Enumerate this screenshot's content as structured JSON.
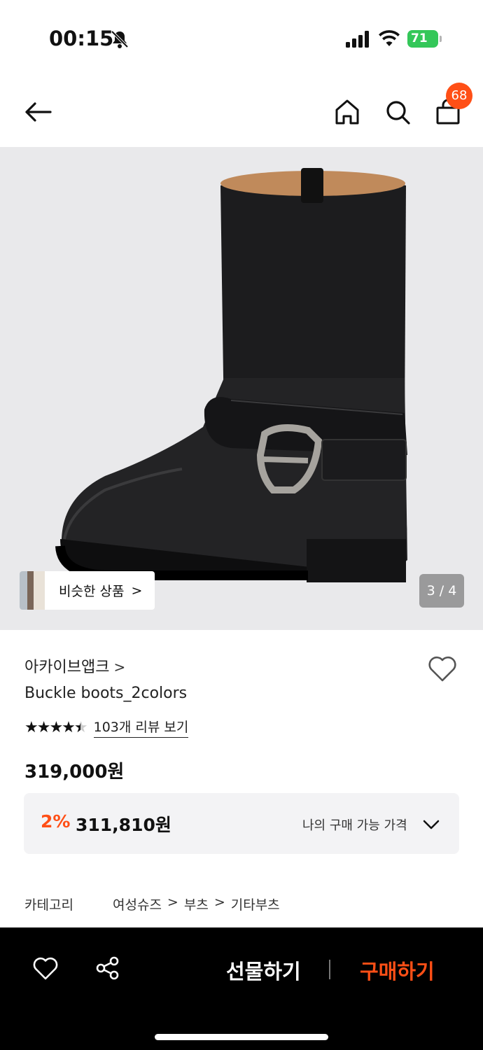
{
  "status_bar": {
    "time": "00:15",
    "battery": "71"
  },
  "header": {
    "cart_count": "68"
  },
  "hero": {
    "similar_label": "비슷한 상품",
    "similar_arrow": ">",
    "pager": "3 / 4"
  },
  "product": {
    "brand": "아카이브앱크",
    "brand_arrow": ">",
    "name": "Buckle boots_2colors",
    "stars": "★★★★",
    "half_star": "★",
    "rating": 4.5,
    "review_link": "103개 리뷰 보기",
    "price": "319,000원",
    "discount_rate": "2%",
    "discount_price": "311,810원",
    "discount_label": "나의 구매 가능 가격",
    "category_label": "카테고리",
    "breadcrumb": [
      "여성슈즈",
      "부츠",
      "기타부츠"
    ],
    "breadcrumb_sep": ">"
  },
  "bottom_bar": {
    "gift_label": "선물하기",
    "buy_label": "구매하기"
  },
  "colors": {
    "accent": "#ff4f16",
    "battery": "#34c759",
    "bottom_bar": "#000000"
  },
  "icons": [
    "back-arrow-icon",
    "home-icon",
    "search-icon",
    "cart-icon",
    "heart-icon",
    "share-icon",
    "chevron-down-icon",
    "bell-off-icon",
    "signal-icon",
    "wifi-icon",
    "battery-icon"
  ]
}
